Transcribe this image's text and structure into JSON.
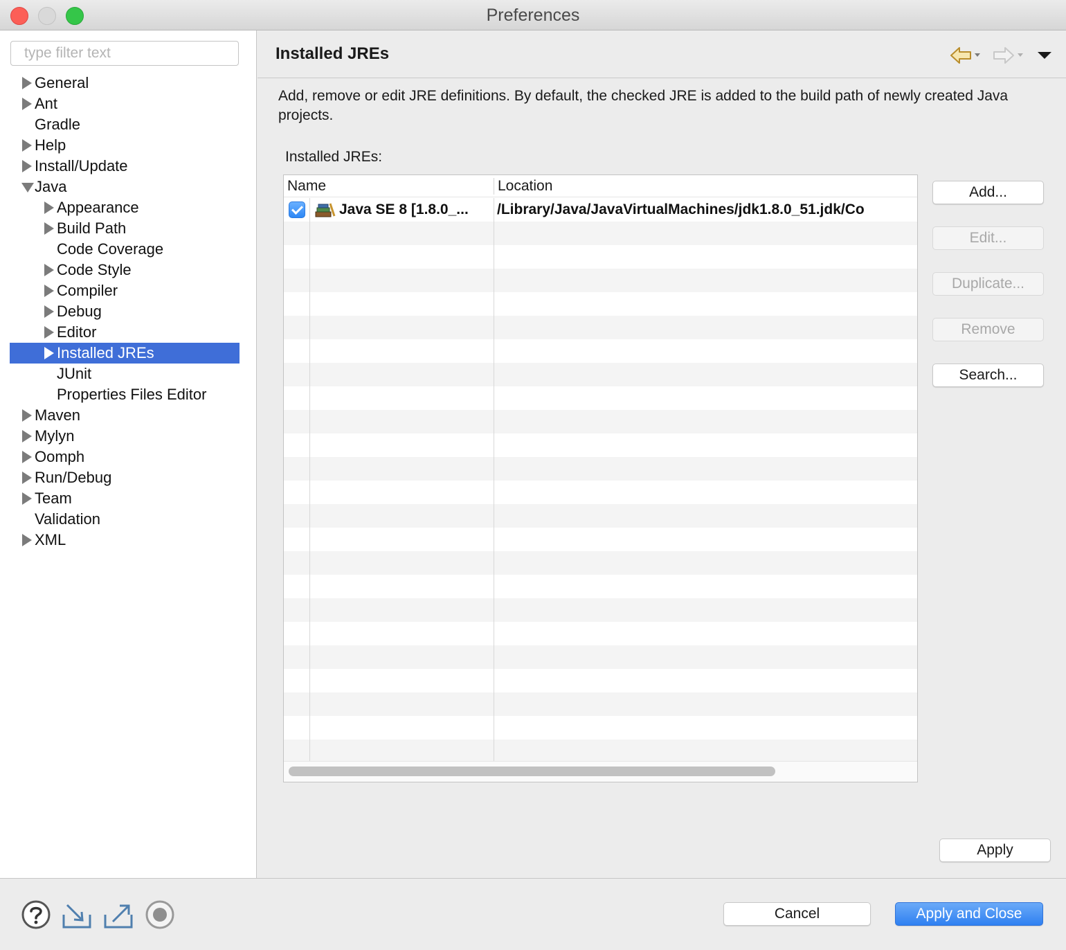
{
  "window": {
    "title": "Preferences"
  },
  "sidebar": {
    "filter_placeholder": "type filter text",
    "items": [
      {
        "label": "General",
        "arrow": "right"
      },
      {
        "label": "Ant",
        "arrow": "right"
      },
      {
        "label": "Gradle",
        "arrow": "none"
      },
      {
        "label": "Help",
        "arrow": "right"
      },
      {
        "label": "Install/Update",
        "arrow": "right"
      },
      {
        "label": "Java",
        "arrow": "down"
      },
      {
        "label": "Appearance",
        "arrow": "right"
      },
      {
        "label": "Build Path",
        "arrow": "right"
      },
      {
        "label": "Code Coverage",
        "arrow": "none"
      },
      {
        "label": "Code Style",
        "arrow": "right"
      },
      {
        "label": "Compiler",
        "arrow": "right"
      },
      {
        "label": "Debug",
        "arrow": "right"
      },
      {
        "label": "Editor",
        "arrow": "right"
      },
      {
        "label": "Installed JREs",
        "arrow": "right",
        "selected": true
      },
      {
        "label": "JUnit",
        "arrow": "none"
      },
      {
        "label": "Properties Files Editor",
        "arrow": "none"
      },
      {
        "label": "Maven",
        "arrow": "right"
      },
      {
        "label": "Mylyn",
        "arrow": "right"
      },
      {
        "label": "Oomph",
        "arrow": "right"
      },
      {
        "label": "Run/Debug",
        "arrow": "right"
      },
      {
        "label": "Team",
        "arrow": "right"
      },
      {
        "label": "Validation",
        "arrow": "none"
      },
      {
        "label": "XML",
        "arrow": "right"
      }
    ]
  },
  "page": {
    "title": "Installed JREs",
    "description": "Add, remove or edit JRE definitions. By default, the checked JRE is added to the build path of newly created Java projects.",
    "table_label": "Installed JREs:",
    "nav_icons": [
      "back-arrow-icon",
      "forward-arrow-icon",
      "view-menu-icon"
    ]
  },
  "table": {
    "columns": [
      "Name",
      "Location"
    ],
    "rows": [
      {
        "checked": true,
        "icon": "jre-library-icon",
        "name": "Java SE 8 [1.8.0_...",
        "location": "/Library/Java/JavaVirtualMachines/jdk1.8.0_51.jdk/Co"
      }
    ],
    "scroll_fraction": 0.78
  },
  "side_buttons": [
    {
      "label": "Add...",
      "enabled": true
    },
    {
      "label": "Edit...",
      "enabled": false
    },
    {
      "label": "Duplicate...",
      "enabled": false
    },
    {
      "label": "Remove",
      "enabled": false
    },
    {
      "label": "Search...",
      "enabled": true
    }
  ],
  "footer": {
    "apply": "Apply",
    "cancel": "Cancel",
    "apply_close": "Apply and Close",
    "icons": [
      "help-icon",
      "import-icon",
      "export-icon",
      "record-icon"
    ]
  },
  "colors": {
    "selection": "#3f6ed8",
    "primary_button": "#2f80f1",
    "close": "#fc5f57",
    "maximize": "#35c649"
  }
}
